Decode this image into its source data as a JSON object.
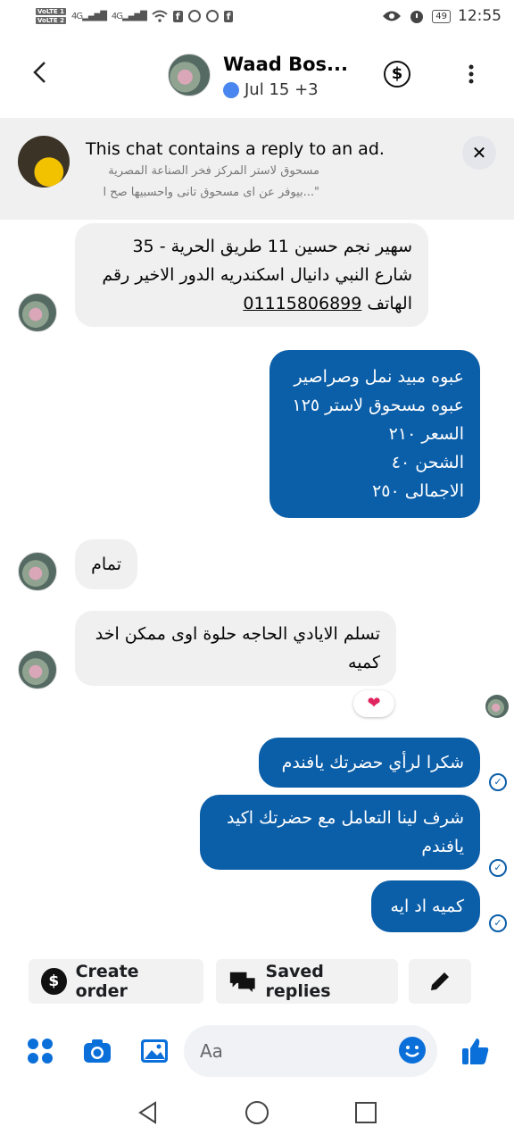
{
  "status_bar": {
    "volte1": "VoLTE 1",
    "volte2": "VoLTE 2",
    "net1": "4G",
    "net2": "4G",
    "battery": "49",
    "time": "12:55"
  },
  "header": {
    "name": "Waad Bos...",
    "subtitle": "Jul 15 +3"
  },
  "ad_banner": {
    "title": "This chat contains a reply to an ad.",
    "line1": "مسحوق لاستر المركز فخر الصناعة المصرية",
    "line2": "\"...بيوفر عن اى مسحوق تانى واحسبيها صح ا"
  },
  "messages": [
    {
      "lines": [
        "سهير نجم حسين 11 طريق الحرية - 35",
        "شارع النبي دانيال اسكندريه الدور الاخير رقم"
      ],
      "line3_prefix": "الهاتف ",
      "phone": "01115806899"
    },
    {
      "lines": [
        "عبوه مبيد نمل وصراصير",
        "عبوه مسحوق لاستر ١٢٥",
        "السعر ٢١٠",
        "الشحن ٤٠",
        "الاجمالى ٢٥٠"
      ]
    },
    {
      "text": "تمام"
    },
    {
      "lines": [
        "تسلم الايادي الحاجه حلوة اوى ممكن اخد",
        "كميه"
      ],
      "reaction": "❤"
    },
    {
      "text": "شكرا لرأي حضرتك يافندم"
    },
    {
      "lines": [
        "شرف لينا التعامل مع حضرتك اكيد",
        "يافندم"
      ]
    },
    {
      "text": "كميه اد ايه"
    }
  ],
  "quick_actions": {
    "create_order": "Create order",
    "saved_replies": "Saved replies"
  },
  "composer": {
    "placeholder": "Aa"
  },
  "colors": {
    "outgoing_bubble": "#0b5ea8",
    "incoming_bubble": "#f0f0f0",
    "accent": "#0b6fd9"
  }
}
